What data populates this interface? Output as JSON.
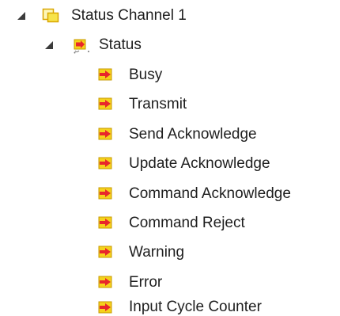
{
  "tree": {
    "root": {
      "label": "Status Channel 1",
      "expanded": true,
      "icon": "folder-channel-icon",
      "children": [
        {
          "label": "Status",
          "expanded": true,
          "icon": "status-struct-icon",
          "children": [
            {
              "label": "Busy",
              "icon": "input-variable-icon"
            },
            {
              "label": "Transmit",
              "icon": "input-variable-icon"
            },
            {
              "label": "Send Acknowledge",
              "icon": "input-variable-icon"
            },
            {
              "label": "Update Acknowledge",
              "icon": "input-variable-icon"
            },
            {
              "label": "Command Acknowledge",
              "icon": "input-variable-icon"
            },
            {
              "label": "Command Reject",
              "icon": "input-variable-icon"
            },
            {
              "label": "Warning",
              "icon": "input-variable-icon"
            },
            {
              "label": "Error",
              "icon": "input-variable-icon"
            },
            {
              "label": "Input Cycle Counter",
              "icon": "input-variable-icon"
            }
          ]
        }
      ]
    }
  },
  "colors": {
    "folder_fill": "#f7e34a",
    "folder_border": "#d9a600",
    "arrow_red": "#e8262b",
    "arrow_yellow": "#f5d21c",
    "text": "#1e1e1e"
  }
}
